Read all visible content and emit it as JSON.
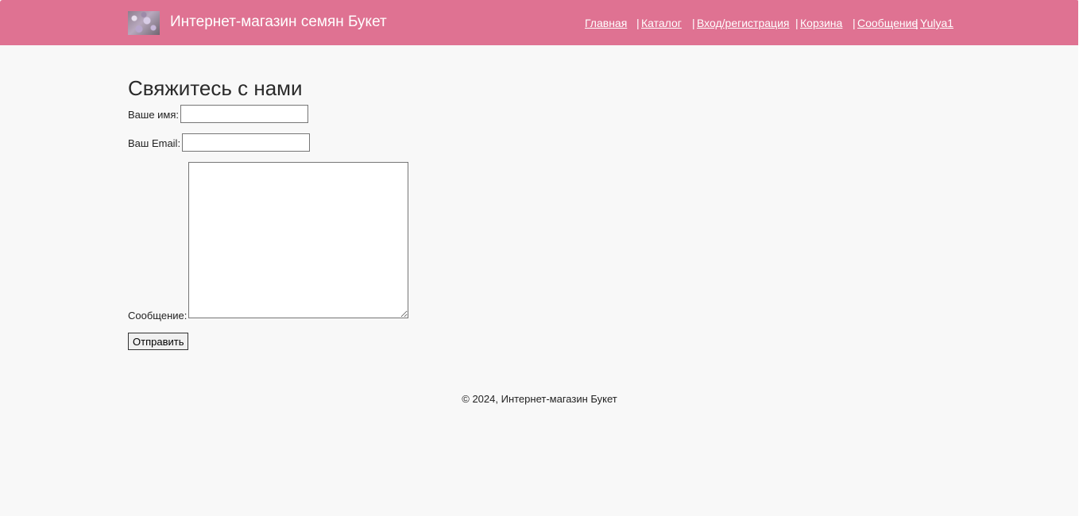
{
  "header": {
    "logo_icon": "flowers-logo-image",
    "site_title": "Интернет-магазин семян Букет",
    "background_color": "#df7292",
    "nav": {
      "home": "Главная",
      "catalog": "Каталог",
      "login": "Вход/регистрация",
      "cart": "Корзина",
      "message": "Сообщение",
      "user": "Yulya1",
      "separator": "|"
    }
  },
  "main": {
    "title": "Свяжитесь с нами",
    "form": {
      "name_label": "Ваше имя:",
      "name_value": "",
      "email_label": "Ваш Email:",
      "email_value": "",
      "message_label": "Сообщение:",
      "message_value": "",
      "submit_label": "Отправить"
    }
  },
  "footer": {
    "copyright": "© 2024, Интернет-магазин Букет"
  }
}
